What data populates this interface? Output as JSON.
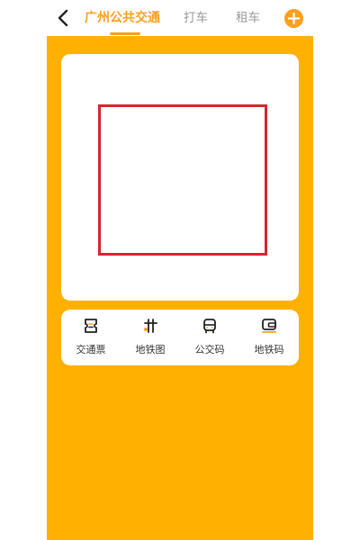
{
  "header": {
    "tabs": [
      {
        "label": "广州公共交通",
        "active": true
      },
      {
        "label": "打车",
        "active": false
      },
      {
        "label": "租车",
        "active": false
      }
    ]
  },
  "actions": [
    {
      "label": "交通票",
      "icon": "ticket-icon"
    },
    {
      "label": "地铁图",
      "icon": "metro-map-icon"
    },
    {
      "label": "公交码",
      "icon": "bus-icon"
    },
    {
      "label": "地铁码",
      "icon": "metro-card-icon"
    }
  ],
  "colors": {
    "accent": "#ff9f1c",
    "background": "#ffb000",
    "qr_frame": "#d9252f"
  }
}
